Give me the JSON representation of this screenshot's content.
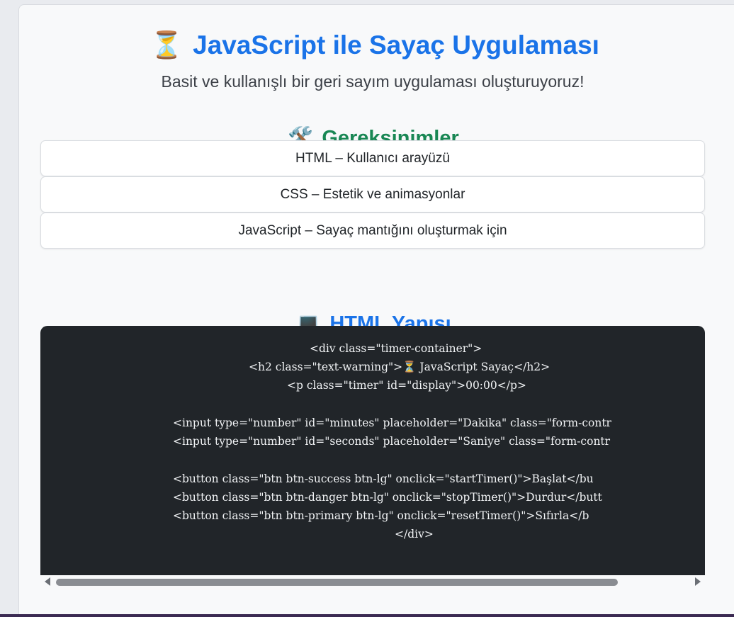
{
  "header": {
    "emoji": "⏳",
    "title": "JavaScript ile Sayaç Uygulaması",
    "subtitle": "Basit ve kullanışlı bir geri sayım uygulaması oluşturuyoruz!"
  },
  "requirements": {
    "emoji": "🛠️",
    "title": "Gereksinimler",
    "items": [
      "HTML – Kullanıcı arayüzü",
      "CSS – Estetik ve animasyonlar",
      "JavaScript – Sayaç mantığını oluşturmak için"
    ]
  },
  "html_section": {
    "emoji": "💻",
    "title": "HTML Yapısı",
    "code_lines": [
      "<div class=\"timer-container\">",
      "<h2 class=\"text-warning\">⏳ JavaScript Sayaç</h2>",
      "<p class=\"timer\" id=\"display\">00:00</p>",
      "<input type=\"number\" id=\"minutes\" placeholder=\"Dakika\" class=\"form-contr",
      "<input type=\"number\" id=\"seconds\" placeholder=\"Saniye\" class=\"form-contr",
      "<button class=\"btn btn-success btn-lg\" onclick=\"startTimer()\">Başlat</bu",
      "<button class=\"btn btn-danger btn-lg\" onclick=\"stopTimer()\">Durdur</butt",
      "<button class=\"btn btn-primary btn-lg\" onclick=\"resetTimer()\">Sıfırla</b",
      "</div>"
    ]
  }
}
